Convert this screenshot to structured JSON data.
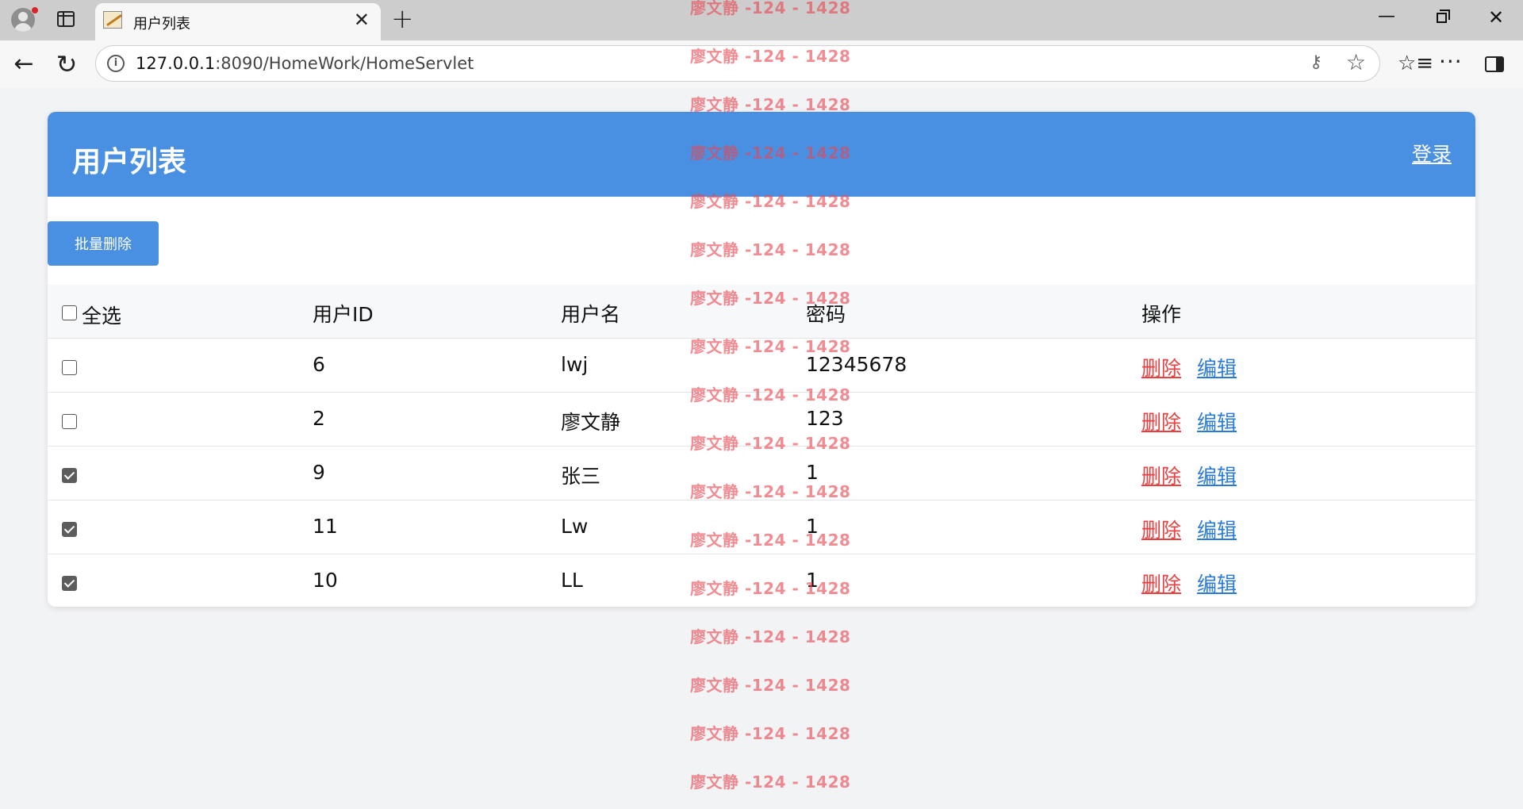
{
  "browser": {
    "tab_title": "用户列表",
    "url_host": "127.0.0.1",
    "url_rest": ":8090/HomeWork/HomeServlet"
  },
  "page": {
    "title": "用户列表",
    "login_label": "登录",
    "batch_delete_label": "批量删除",
    "select_all_label": "全选"
  },
  "table": {
    "columns": [
      "用户ID",
      "用户名",
      "密码",
      "操作"
    ],
    "delete_label": "删除",
    "edit_label": "编辑",
    "rows": [
      {
        "id": "6",
        "username": "lwj",
        "password": "12345678",
        "checked": false
      },
      {
        "id": "2",
        "username": "廖文静",
        "password": "123",
        "checked": false
      },
      {
        "id": "9",
        "username": "张三",
        "password": "1",
        "checked": true
      },
      {
        "id": "11",
        "username": "Lw",
        "password": "1",
        "checked": true
      },
      {
        "id": "10",
        "username": "LL",
        "password": "1",
        "checked": true
      }
    ]
  },
  "watermark": {
    "text": "廖文静 -124 - 1428",
    "color": "#e84650"
  },
  "colors": {
    "header_bg": "#4a90e2",
    "delete_link": "#e84040",
    "edit_link": "#2b7bd6"
  }
}
